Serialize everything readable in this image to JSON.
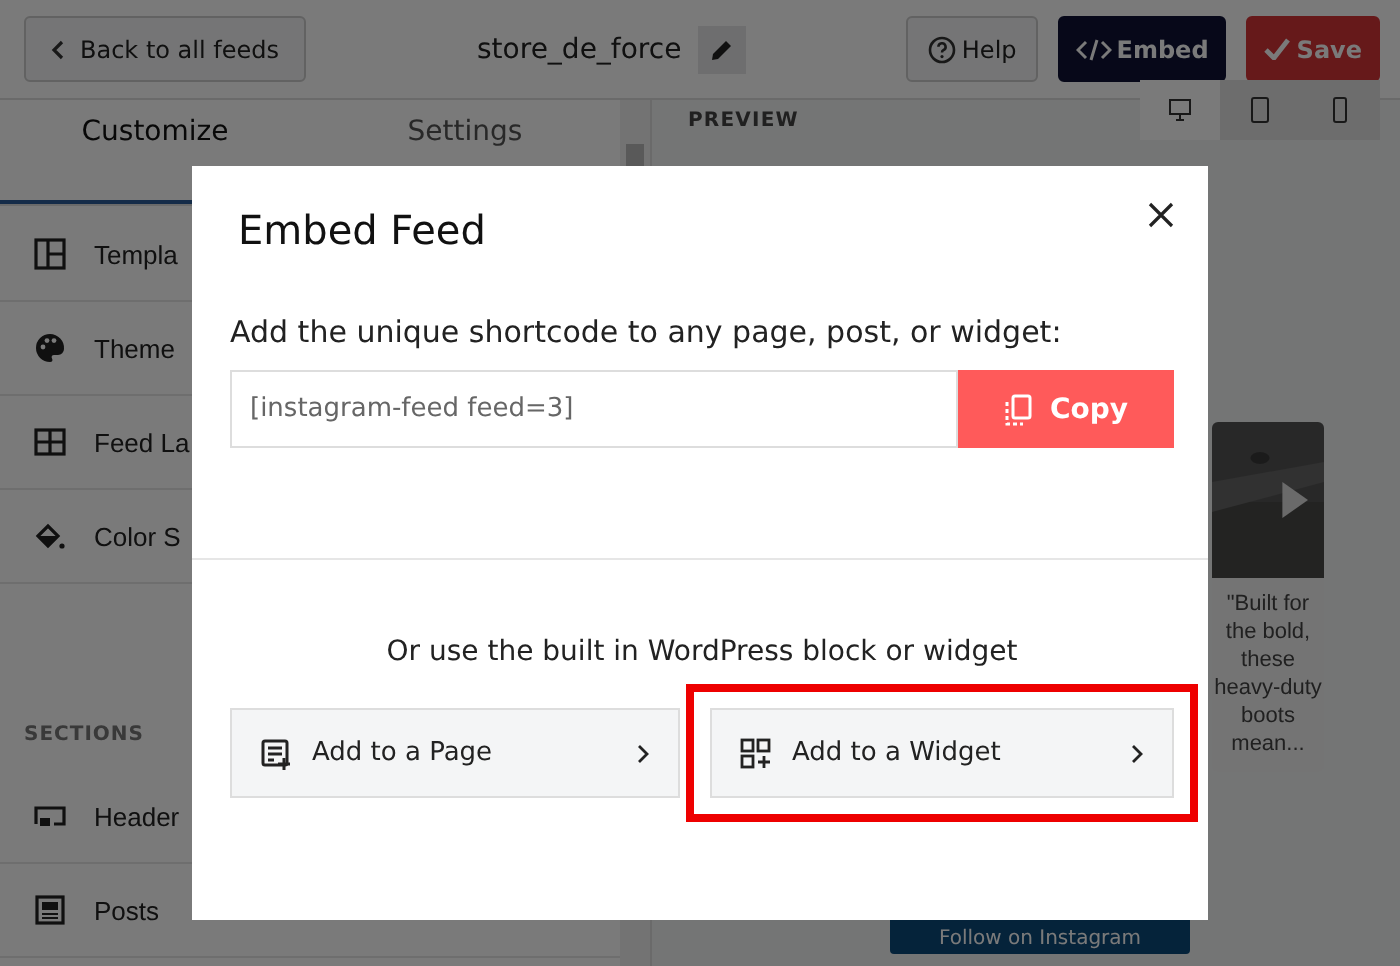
{
  "topbar": {
    "back_button": "Back to all feeds",
    "feed_name": "store_de_force",
    "help_button": "Help",
    "embed_button": "Embed",
    "save_button": "Save"
  },
  "sidebar": {
    "tabs": [
      {
        "label": "Customize",
        "selected": true
      },
      {
        "label": "Settings",
        "selected": false
      }
    ],
    "items": [
      {
        "label": "Templa"
      },
      {
        "label": "Theme"
      },
      {
        "label": "Feed La"
      },
      {
        "label": "Color S"
      }
    ],
    "section_heading": "SECTIONS",
    "section_items": [
      {
        "label": "Header"
      },
      {
        "label": "Posts"
      }
    ]
  },
  "preview": {
    "heading": "PREVIEW",
    "devices": [
      {
        "kind": "desktop",
        "selected": true
      },
      {
        "kind": "tablet",
        "selected": false
      },
      {
        "kind": "phone",
        "selected": false
      }
    ],
    "post_caption": "\"Built for the bold, these heavy-duty boots mean...",
    "follow_button": "Follow on Instagram"
  },
  "modal": {
    "title": "Embed Feed",
    "shortcode_label": "Add the unique shortcode to any page, post, or widget:",
    "shortcode_value": "[instagram-feed feed=3]",
    "copy_button": "Copy",
    "alt_label": "Or use the built in WordPress block or widget",
    "options": [
      {
        "label": "Add to a Page",
        "highlighted": false
      },
      {
        "label": "Add to a Widget",
        "highlighted": true
      }
    ]
  }
}
